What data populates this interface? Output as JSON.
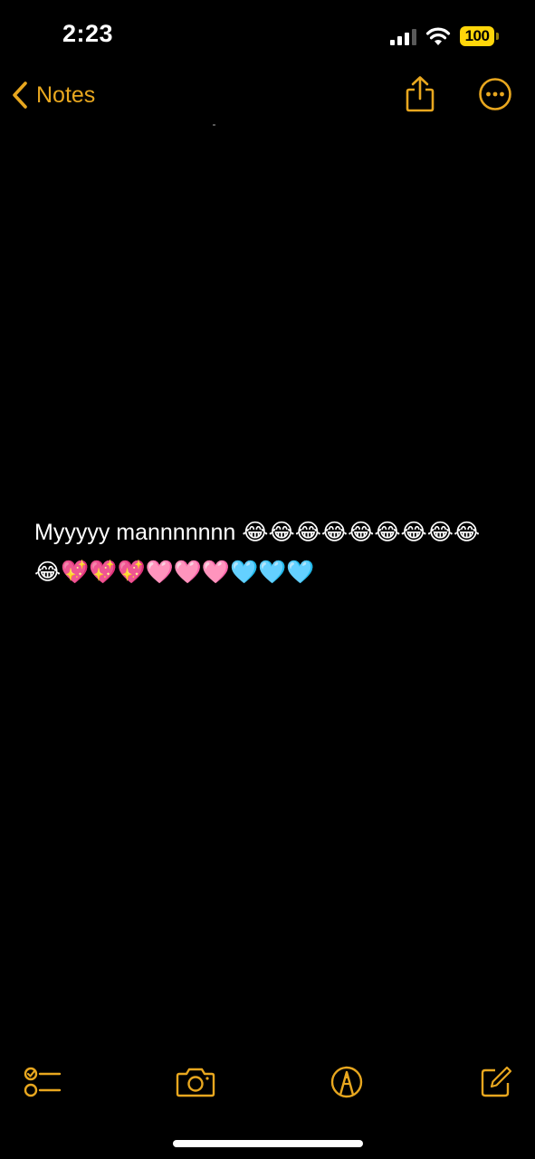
{
  "status_bar": {
    "time": "2:23",
    "battery_level": "100",
    "cellular_icon": "cellular-signal-icon",
    "wifi_icon": "wifi-icon"
  },
  "nav": {
    "back_label": "Notes",
    "back_icon": "chevron-left-icon",
    "share_icon": "share-icon",
    "more_icon": "ellipsis-circle-icon"
  },
  "note": {
    "body": "Myyyyy mannnnnnn 😂😂😂😂😂😂😂😂😂😂💖💖💖🩷🩷🩷🩵🩵🩵"
  },
  "toolbar": {
    "checklist_icon": "checklist-icon",
    "camera_icon": "camera-icon",
    "markup_icon": "markup-pen-icon",
    "compose_icon": "compose-icon"
  },
  "colors": {
    "accent": "#e8a71f",
    "battery": "#ffd60a",
    "background": "#000000",
    "text": "#ffffff"
  }
}
